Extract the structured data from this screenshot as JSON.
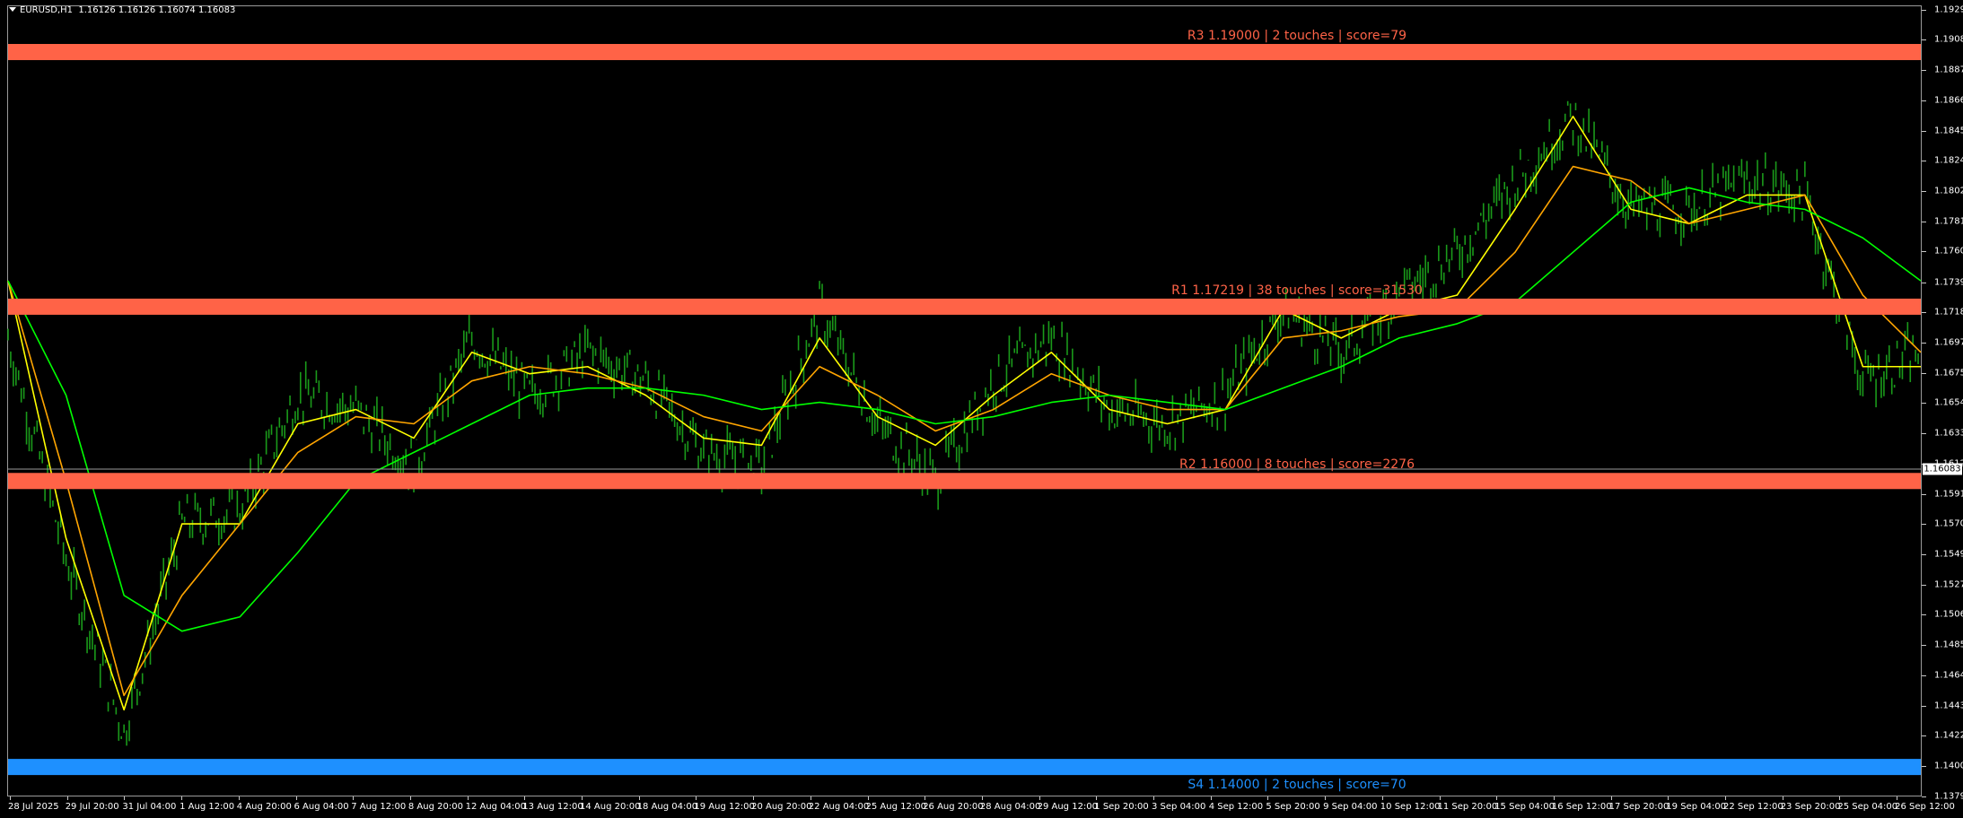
{
  "header": {
    "symbol": "EURUSD,H1",
    "ohlc": "1.16126 1.16126 1.16074 1.16083"
  },
  "price_axis": {
    "labels": [
      "1.19295",
      "1.19085",
      "1.18875",
      "1.18660",
      "1.18450",
      "1.18240",
      "1.18025",
      "1.17815",
      "1.17605",
      "1.17390",
      "1.17180",
      "1.16970",
      "1.16755",
      "1.16545",
      "1.16335",
      "1.16120",
      "1.15910",
      "1.15700",
      "1.15490",
      "1.15275",
      "1.15066",
      "1.14855",
      "1.14640",
      "1.14430",
      "1.14220",
      "1.14005",
      "1.13795"
    ],
    "current_bid": "1.16083"
  },
  "time_axis": {
    "labels": [
      "28 Jul 2025",
      "29 Jul 20:00",
      "31 Jul 04:00",
      "1 Aug 12:00",
      "4 Aug 20:00",
      "6 Aug 04:00",
      "7 Aug 12:00",
      "8 Aug 20:00",
      "12 Aug 04:00",
      "13 Aug 12:00",
      "14 Aug 20:00",
      "18 Aug 04:00",
      "19 Aug 12:00",
      "20 Aug 20:00",
      "22 Aug 04:00",
      "25 Aug 12:00",
      "26 Aug 20:00",
      "28 Aug 04:00",
      "29 Aug 12:00",
      "1 Sep 20:00",
      "3 Sep 04:00",
      "4 Sep 12:00",
      "5 Sep 20:00",
      "9 Sep 04:00",
      "10 Sep 12:00",
      "11 Sep 20:00",
      "15 Sep 04:00",
      "16 Sep 12:00",
      "17 Sep 20:00",
      "19 Sep 04:00",
      "22 Sep 12:00",
      "23 Sep 20:00",
      "25 Sep 04:00",
      "26 Sep 12:00"
    ]
  },
  "levels": [
    {
      "label": "R3 1.19000 | 2 touches | score=79",
      "price": 1.19,
      "color": "#ff6347",
      "text_color": "#ff6347"
    },
    {
      "label": "R1 1.17219 | 38 touches | score=31530",
      "price": 1.17219,
      "color": "#ff6347",
      "text_color": "#ff6347"
    },
    {
      "label": "R2 1.16000 | 8 touches | score=2276",
      "price": 1.16,
      "color": "#ff6347",
      "text_color": "#ff6347"
    },
    {
      "label": "S4 1.14000 | 2 touches | score=70",
      "price": 1.14,
      "color": "#1e90ff",
      "text_color": "#1e90ff"
    }
  ],
  "chart_data": {
    "type": "line",
    "title": "",
    "xlabel": "",
    "ylabel": "",
    "ylim": [
      1.138,
      1.1932
    ],
    "x": [
      "28 Jul 2025",
      "29 Jul 20:00",
      "31 Jul 04:00",
      "1 Aug 12:00",
      "4 Aug 20:00",
      "6 Aug 04:00",
      "7 Aug 12:00",
      "8 Aug 20:00",
      "12 Aug 04:00",
      "13 Aug 12:00",
      "14 Aug 20:00",
      "18 Aug 04:00",
      "19 Aug 12:00",
      "20 Aug 20:00",
      "22 Aug 04:00",
      "25 Aug 12:00",
      "26 Aug 20:00",
      "28 Aug 04:00",
      "29 Aug 12:00",
      "1 Sep 20:00",
      "3 Sep 04:00",
      "4 Sep 12:00",
      "5 Sep 20:00",
      "9 Sep 04:00",
      "10 Sep 12:00",
      "11 Sep 20:00",
      "15 Sep 04:00",
      "16 Sep 12:00",
      "17 Sep 20:00",
      "19 Sep 04:00",
      "22 Sep 12:00",
      "23 Sep 20:00",
      "25 Sep 04:00",
      "26 Sep 12:00"
    ],
    "price_bars": [
      1.17,
      1.1545,
      1.1425,
      1.157,
      1.158,
      1.166,
      1.165,
      1.161,
      1.17,
      1.166,
      1.169,
      1.167,
      1.162,
      1.161,
      1.172,
      1.164,
      1.16,
      1.167,
      1.17,
      1.165,
      1.164,
      1.166,
      1.172,
      1.169,
      1.173,
      1.176,
      1.181,
      1.1855,
      1.179,
      1.179,
      1.181,
      1.18,
      1.167,
      1.169
    ],
    "series": [
      {
        "color": "#ffff00",
        "values": [
          1.174,
          1.156,
          1.144,
          1.157,
          1.157,
          1.164,
          1.165,
          1.163,
          1.169,
          1.1675,
          1.168,
          1.166,
          1.163,
          1.1625,
          1.17,
          1.1645,
          1.1625,
          1.166,
          1.169,
          1.165,
          1.164,
          1.165,
          1.172,
          1.17,
          1.172,
          1.173,
          1.179,
          1.1855,
          1.179,
          1.178,
          1.18,
          1.18,
          1.168,
          1.168
        ]
      },
      {
        "color": "#ffa500",
        "values": [
          1.174,
          1.16,
          1.145,
          1.152,
          1.157,
          1.162,
          1.1645,
          1.164,
          1.167,
          1.168,
          1.1675,
          1.1665,
          1.1645,
          1.1635,
          1.168,
          1.166,
          1.1635,
          1.165,
          1.1675,
          1.166,
          1.165,
          1.165,
          1.17,
          1.1705,
          1.1715,
          1.172,
          1.176,
          1.182,
          1.181,
          1.178,
          1.179,
          1.18,
          1.173,
          1.169
        ]
      },
      {
        "color": "#00ff00",
        "values": [
          1.174,
          1.166,
          1.152,
          1.1495,
          1.1505,
          1.155,
          1.16,
          1.162,
          1.164,
          1.166,
          1.1665,
          1.1665,
          1.166,
          1.165,
          1.1655,
          1.165,
          1.164,
          1.1645,
          1.1655,
          1.166,
          1.1655,
          1.165,
          1.1665,
          1.168,
          1.17,
          1.171,
          1.1725,
          1.176,
          1.1795,
          1.1805,
          1.1795,
          1.179,
          1.177,
          1.174
        ]
      }
    ]
  }
}
